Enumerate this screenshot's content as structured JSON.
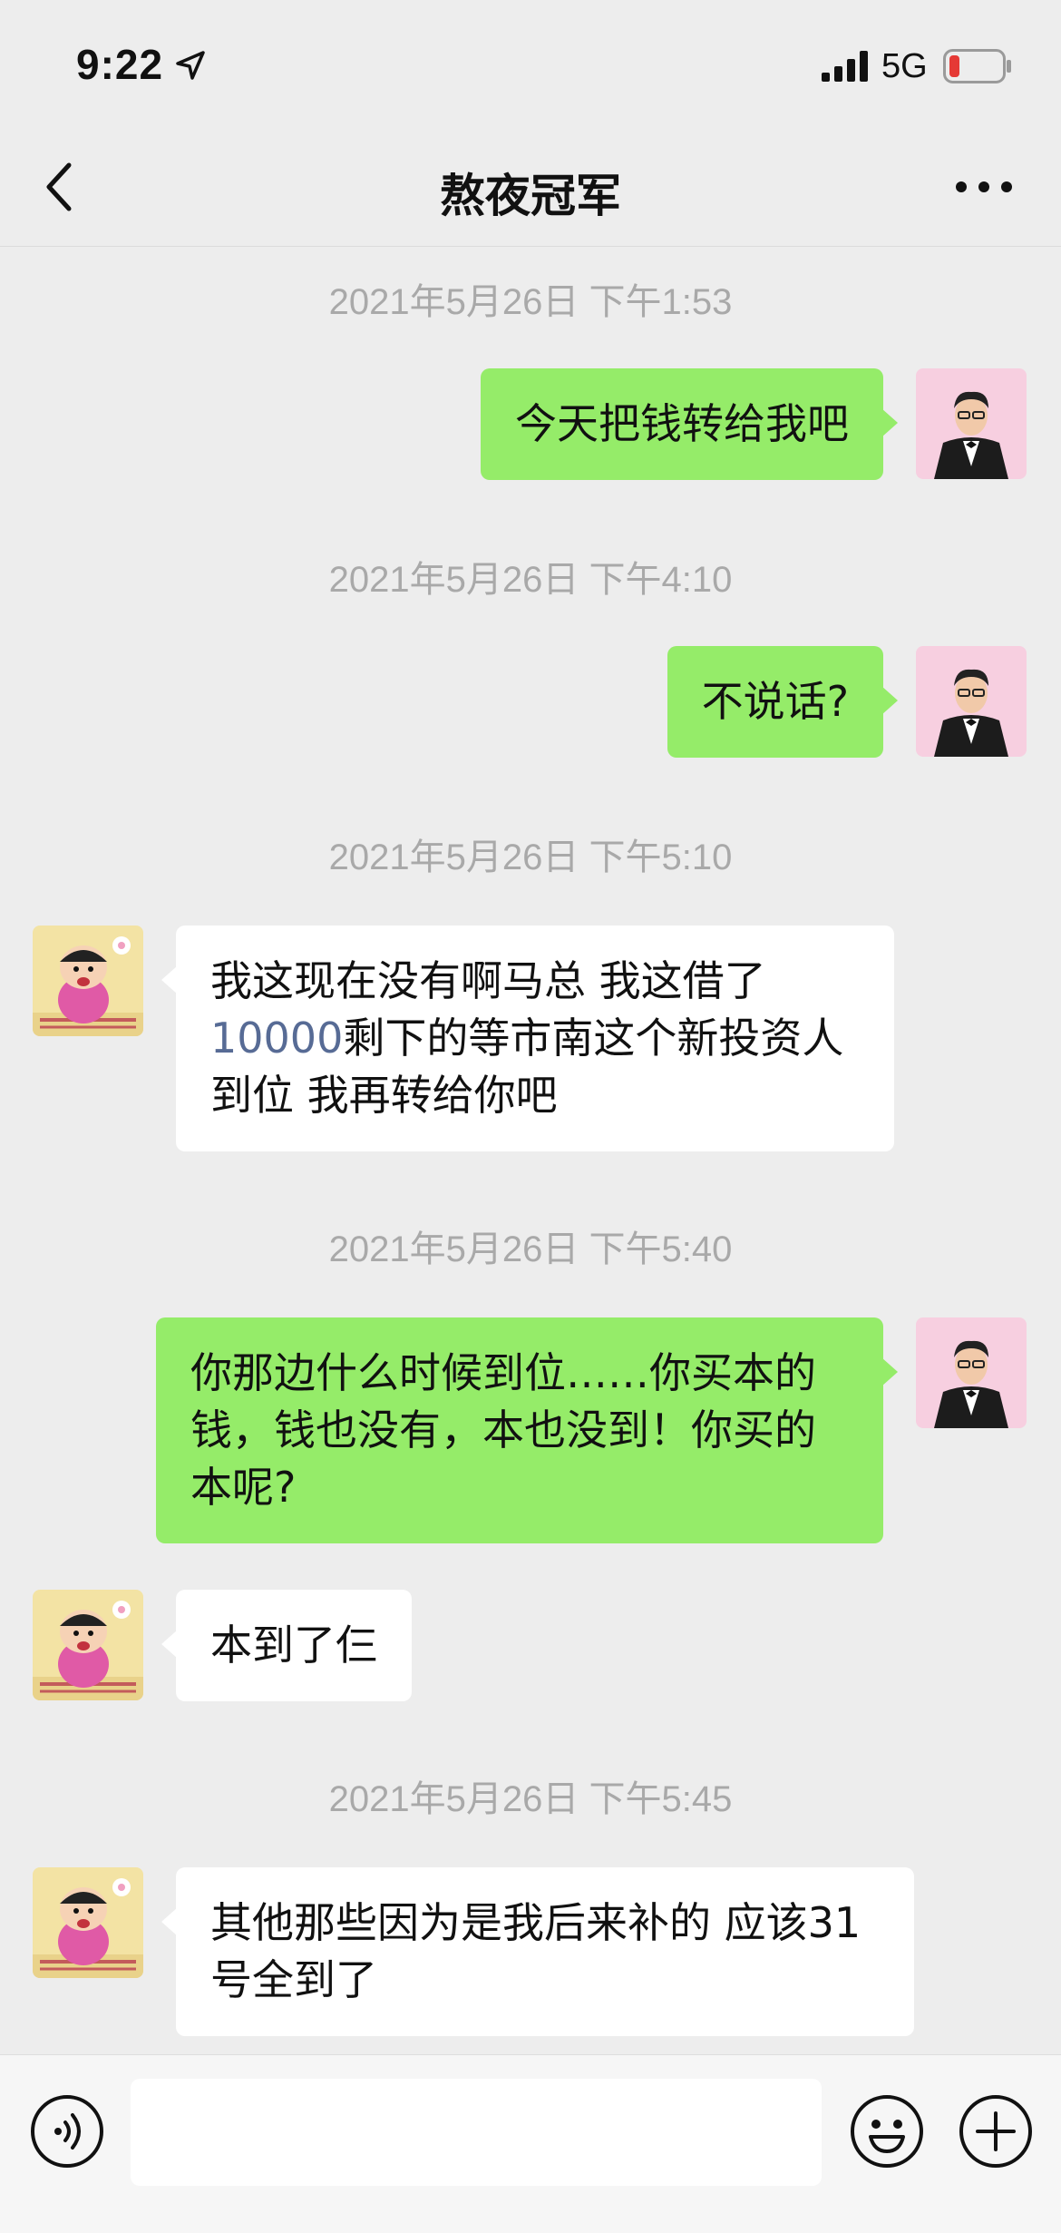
{
  "status_bar": {
    "time": "9:22",
    "network": "5G",
    "icons": [
      "location-arrow-icon",
      "signal-bars-icon",
      "battery-low-icon"
    ],
    "battery_color": "#e53935"
  },
  "nav": {
    "title": "熬夜冠军",
    "icons": [
      "back-chevron-icon",
      "more-dots-icon"
    ]
  },
  "messages": [
    {
      "type": "time",
      "text": "2021年5月26日 下午1:53"
    },
    {
      "type": "sent",
      "text": "今天把钱转给我吧"
    },
    {
      "type": "time",
      "text": "2021年5月26日 下午4:10"
    },
    {
      "type": "sent",
      "text": "不说话?"
    },
    {
      "type": "time",
      "text": "2021年5月26日 下午5:10"
    },
    {
      "type": "received",
      "text_pre": "我这现在没有啊马总 我这借了",
      "link_number": "10000",
      "text_post": "剩下的等市南这个新投资人到位 我再转给你吧"
    },
    {
      "type": "time",
      "text": "2021年5月26日 下午5:40"
    },
    {
      "type": "sent",
      "text": "你那边什么时候到位……你买本的钱，钱也没有，本也没到！你买的本呢?"
    },
    {
      "type": "received",
      "text": "本到了仨"
    },
    {
      "type": "time",
      "text": "2021年5月26日 下午5:45"
    },
    {
      "type": "received",
      "text": "其他那些因为是我后来补的 应该31号全到了"
    }
  ],
  "input_bar": {
    "placeholder": "",
    "icons": [
      "voice-icon",
      "emoji-icon",
      "plus-icon"
    ]
  },
  "colors": {
    "background": "#ededed",
    "sent_bubble": "#95ec69",
    "received_bubble": "#ffffff",
    "timestamp_text": "#a9a9a9",
    "link": "#576b95"
  }
}
